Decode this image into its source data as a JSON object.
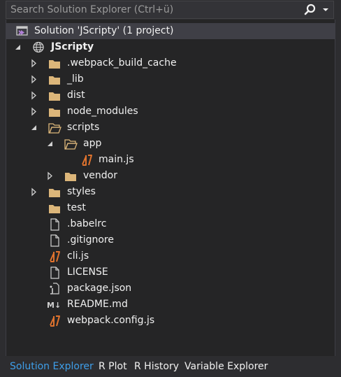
{
  "search": {
    "placeholder": "Search Solution Explorer (Ctrl+ü)",
    "search_icon": "search-icon",
    "dropdown_icon": "dropdown-arrow-icon"
  },
  "tree": {
    "items": [
      {
        "label": "Solution 'JScripty' (1 project)",
        "icon": "solution-icon",
        "twisty": "none"
      },
      {
        "label": "JScripty",
        "icon": "web-project-icon",
        "twisty": "expanded"
      },
      {
        "label": ".webpack_build_cache",
        "icon": "folder-icon",
        "twisty": "collapsed"
      },
      {
        "label": "_lib",
        "icon": "folder-icon",
        "twisty": "collapsed"
      },
      {
        "label": "dist",
        "icon": "folder-icon",
        "twisty": "collapsed"
      },
      {
        "label": "node_modules",
        "icon": "folder-icon",
        "twisty": "collapsed"
      },
      {
        "label": "scripts",
        "icon": "folder-open-icon",
        "twisty": "expanded"
      },
      {
        "label": "app",
        "icon": "folder-open-icon",
        "twisty": "expanded"
      },
      {
        "label": "main.js",
        "icon": "javascript-file-icon",
        "twisty": "none"
      },
      {
        "label": "vendor",
        "icon": "folder-icon",
        "twisty": "collapsed"
      },
      {
        "label": "styles",
        "icon": "folder-icon",
        "twisty": "collapsed"
      },
      {
        "label": "test",
        "icon": "folder-icon",
        "twisty": "none"
      },
      {
        "label": ".babelrc",
        "icon": "file-icon",
        "twisty": "none"
      },
      {
        "label": ".gitignore",
        "icon": "file-icon",
        "twisty": "none"
      },
      {
        "label": "cli.js",
        "icon": "javascript-file-icon",
        "twisty": "none"
      },
      {
        "label": "LICENSE",
        "icon": "file-icon",
        "twisty": "none"
      },
      {
        "label": "package.json",
        "icon": "json-file-icon",
        "twisty": "none"
      },
      {
        "label": "README.md",
        "icon": "markdown-file-icon",
        "twisty": "none"
      },
      {
        "label": "webpack.config.js",
        "icon": "javascript-file-icon",
        "twisty": "none"
      }
    ]
  },
  "tabs": [
    {
      "label": "Solution Explorer",
      "active": true
    },
    {
      "label": "R Plot",
      "active": false
    },
    {
      "label": "R History",
      "active": false
    },
    {
      "label": "Variable Explorer",
      "active": false
    }
  ],
  "colors": {
    "background": "#2d2d30",
    "tree_background": "#252526",
    "selection": "#3f3f46",
    "folder": "#dcb67a",
    "javascript": "#e0732e",
    "active_tab": "#3e9ee9"
  }
}
